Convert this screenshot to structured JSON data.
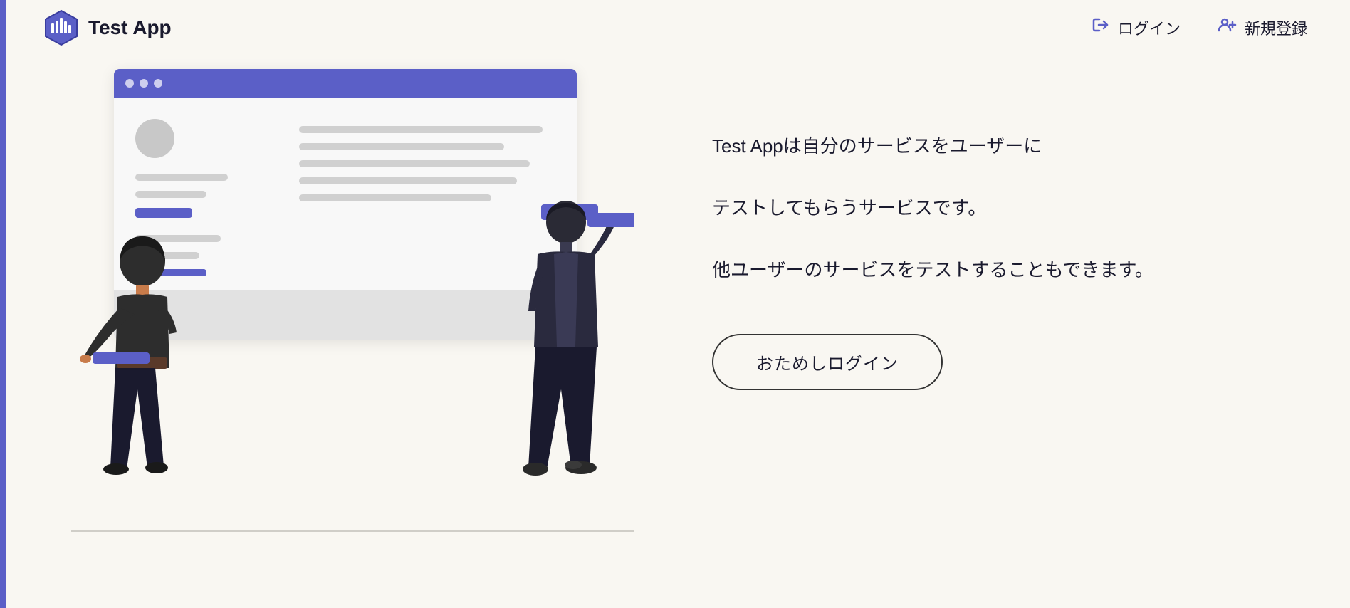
{
  "app": {
    "name": "Test App",
    "logo_alt": "Test App logo"
  },
  "header": {
    "login_label": "ログイン",
    "register_label": "新規登録",
    "login_icon": "→)",
    "register_icon": "👤+"
  },
  "hero": {
    "line1": "Test Appは自分のサービスをユーザーに",
    "line2": "テストしてもらうサービスです。",
    "line3": "他ユーザーのサービスをテストすることもできます。",
    "trial_button": "おためしログイン"
  },
  "colors": {
    "accent": "#5b5fc7",
    "background": "#f9f7f2",
    "text_dark": "#1a1a2e"
  }
}
